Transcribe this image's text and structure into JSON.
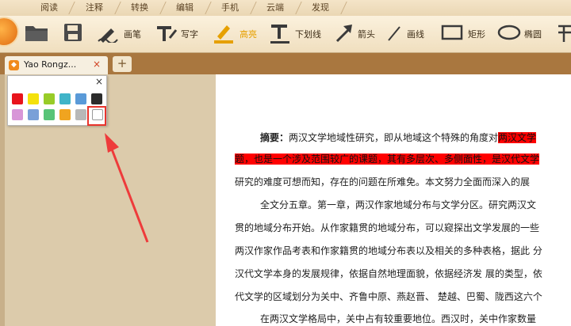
{
  "menu": {
    "tabs": [
      "阅读",
      "注释",
      "转换",
      "编辑",
      "手机",
      "云端",
      "发现"
    ]
  },
  "toolbar": {
    "tools": [
      {
        "label": "画笔",
        "icon": "pen-icon"
      },
      {
        "label": "写字",
        "icon": "text-tool-icon"
      },
      {
        "label": "高亮",
        "icon": "highlighter-icon"
      },
      {
        "label": "下划线",
        "icon": "underline-icon"
      },
      {
        "label": "箭头",
        "icon": "arrow-icon"
      },
      {
        "label": "画线",
        "icon": "line-icon"
      },
      {
        "label": "矩形",
        "icon": "rectangle-icon"
      },
      {
        "label": "椭圆",
        "icon": "ellipse-icon"
      }
    ]
  },
  "tab": {
    "title": "Yao Rongz...",
    "close": "×",
    "new": "+"
  },
  "popup": {
    "close": "×",
    "colors_row1": [
      "#e8141c",
      "#f4e10c",
      "#98cc28",
      "#40b4c8",
      "#5a9ad8",
      "#2c2c2c"
    ],
    "colors_row2": [
      "#d896d8",
      "#7aa0d8",
      "#58c478",
      "#f0a420",
      "#b8b8b8",
      "#ffffff"
    ]
  },
  "doc": {
    "abstract_label": "摘要：",
    "line1_a": "两汉文学地域性研究，即从地域这个特殊的角度对",
    "line1_hl": "两汉文学",
    "line2_hl": "题，也是一个涉及范围较广的课题，其有多层次、多侧面性，是汉代文学",
    "line3": "研究的难度可想而知，存在的问题在所难免。本文努力全面而深入的展",
    "line4": "全文分五章。第一章，两汉作家地域分布与文学分区。研究两汉文",
    "line5": "贯的地域分布开始。从作家籍贯的地域分布，可以窥探出文学发展的一些",
    "line6": "两汉作家作品考表和作家籍贯的地域分布表以及相关的多种表格，据此 分",
    "line7": "汉代文学本身的发展规律，依据自然地理面貌，依据经济发 展的类型，依",
    "line8": "代文学的区域划分为关中、齐鲁中原、燕赵晋、 楚越、巴蜀、陇西这六个",
    "line9": "在两汉文学格局中，关中占有较重要地位。西汉时，关中作家数量"
  }
}
